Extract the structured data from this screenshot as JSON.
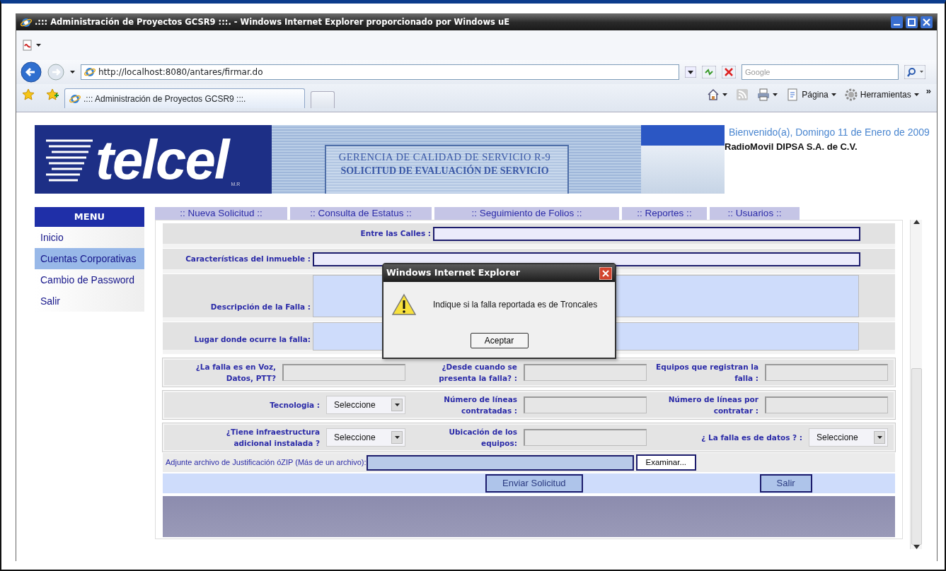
{
  "window": {
    "title": ".::: Administración de Proyectos GCSR9 :::. - Windows Internet Explorer proporcionado por Windows uE"
  },
  "browser": {
    "address": "http://localhost:8080/antares/firmar.do",
    "search_placeholder": "Google",
    "tabs": [
      {
        "label": ".::: Administración de Proyectos GCSR9 :::.",
        "selected": true
      }
    ],
    "commands": [
      {
        "kind": "home"
      },
      {
        "kind": "feeds"
      },
      {
        "kind": "print"
      },
      {
        "kind": "page",
        "label": "Página"
      },
      {
        "kind": "tools",
        "label": "Herramientas"
      }
    ],
    "overflow": "»"
  },
  "banner": {
    "logo": "telcel",
    "logo_mark": "M.R",
    "title_lines": [
      "GERENCIA DE CALIDAD DE SERVICIO R-9",
      "SOLICITUD DE EVALUACIÓN DE SERVICIO"
    ]
  },
  "welcome": "Bienvenido(a), Domingo 11 de Enero de 2009",
  "company": "RadioMovil DIPSA S.A. de C.V.",
  "menu": {
    "title": "MENU",
    "items": [
      {
        "label": "Inicio",
        "selected": false
      },
      {
        "label": "Cuentas Corporativas",
        "selected": true
      },
      {
        "label": "Cambio de Password",
        "selected": false
      },
      {
        "label": "Salir",
        "selected": false
      }
    ]
  },
  "nav_tabs": [
    {
      "label": ":: Nueva Solicitud ::",
      "selected": false
    },
    {
      "label": ":: Consulta de Estatus ::",
      "selected": false
    },
    {
      "label": ":: Seguimiento de Folios ::",
      "selected": false
    },
    {
      "label": ":: Reportes ::",
      "selected": false
    },
    {
      "label": ":: Usuarios ::",
      "selected": false
    }
  ],
  "form": {
    "rows": [
      {
        "kind": "input",
        "label": "Entre las Calles :"
      },
      {
        "kind": "input",
        "label": "Características del inmueble :"
      },
      {
        "kind": "textarea",
        "label": "Descripción de la Falla :"
      },
      {
        "kind": "textarea",
        "label": "Lugar donde ocurre la falla:"
      },
      {
        "kind": "triple",
        "fields": [
          {
            "label": "¿La falla es en Voz, Datos, PTT?",
            "kind": "input"
          },
          {
            "label": "¿Desde cuando se presenta la falla? :",
            "kind": "input"
          },
          {
            "label": "Equipos que registran la falla :",
            "kind": "input"
          }
        ]
      },
      {
        "kind": "triple",
        "fields": [
          {
            "label": "Tecnologia :",
            "kind": "select",
            "value": "Seleccione"
          },
          {
            "label": "Número de líneas contratadas :",
            "kind": "input"
          },
          {
            "label": "Número de líneas por contratar :",
            "kind": "input"
          }
        ]
      },
      {
        "kind": "triple",
        "fields": [
          {
            "label": "¿Tiene infraestructura adicional instalada ?",
            "kind": "select",
            "value": "Seleccione"
          },
          {
            "label": "Ubicación de los equipos:",
            "kind": "input"
          },
          {
            "label": "¿ La falla es de datos ? :",
            "kind": "select",
            "value": "Seleccione"
          }
        ]
      },
      {
        "kind": "file",
        "label": "Adjunte archivo de Justificación óZIP (Más de un archivo):",
        "button": "Examinar..."
      },
      {
        "kind": "actions",
        "buttons": [
          "Enviar Solicitud",
          "Salir"
        ]
      }
    ]
  },
  "dialog": {
    "title": "Windows Internet Explorer",
    "message": "Indique si la falla reportada es de Troncales",
    "button": "Aceptar"
  }
}
